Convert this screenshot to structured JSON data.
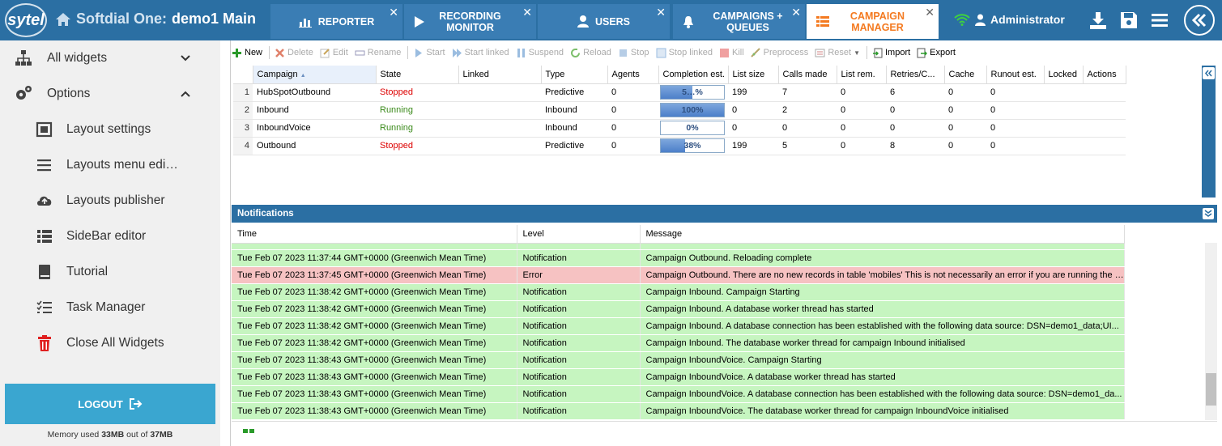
{
  "app": {
    "logo_text": "sytel",
    "product": "Softdial One:",
    "instance": "demo1 Main"
  },
  "tabs": [
    {
      "label": "REPORTER",
      "icon": "chart-icon"
    },
    {
      "label": "RECORDING MONITOR",
      "icon": "play-icon"
    },
    {
      "label": "USERS",
      "icon": "user-icon"
    },
    {
      "label": "CAMPAIGNS + QUEUES",
      "icon": "bell-icon"
    },
    {
      "label": "CAMPAIGN MANAGER",
      "icon": "grid-icon",
      "active": true
    }
  ],
  "header": {
    "user": "Administrator"
  },
  "sidebar": {
    "items": [
      {
        "label": "All widgets",
        "icon": "sitemap-icon"
      },
      {
        "label": "Options",
        "icon": "gears-icon"
      },
      {
        "label": "Layout settings",
        "icon": "layout-icon"
      },
      {
        "label": "Layouts menu edi…",
        "icon": "menu-icon"
      },
      {
        "label": "Layouts publisher",
        "icon": "cloud-upload-icon"
      },
      {
        "label": "SideBar editor",
        "icon": "list-icon"
      },
      {
        "label": "Tutorial",
        "icon": "book-icon"
      },
      {
        "label": "Task Manager",
        "icon": "tasks-icon"
      },
      {
        "label": "Close All Widgets",
        "icon": "trash-icon"
      }
    ],
    "logout_label": "LOGOUT",
    "memory_prefix": "Memory used ",
    "memory_used": "33MB",
    "memory_mid": " out of ",
    "memory_total": "37MB"
  },
  "toolbar": {
    "new": "New",
    "delete": "Delete",
    "edit": "Edit",
    "rename": "Rename",
    "start": "Start",
    "start_linked": "Start linked",
    "suspend": "Suspend",
    "reload": "Reload",
    "stop": "Stop",
    "stop_linked": "Stop linked",
    "kill": "Kill",
    "preprocess": "Preprocess",
    "reset": "Reset",
    "import": "Import",
    "export": "Export"
  },
  "campaigns": {
    "columns": [
      "Campaign",
      "State",
      "Linked",
      "Type",
      "Agents",
      "Completion est.",
      "List size",
      "Calls made",
      "List rem.",
      "Retries/C...",
      "Cache",
      "Runout est.",
      "Locked",
      "Actions"
    ],
    "rows": [
      {
        "n": "1",
        "campaign": "HubSpotOutbound",
        "state": "Stopped",
        "linked": "",
        "type": "Predictive",
        "agents": "0",
        "completion": 50,
        "completion_label": "5…%",
        "list_size": "199",
        "calls_made": "7",
        "list_rem": "0",
        "retries": "6",
        "cache": "0",
        "runout": "0"
      },
      {
        "n": "2",
        "campaign": "Inbound",
        "state": "Running",
        "linked": "",
        "type": "Inbound",
        "agents": "0",
        "completion": 100,
        "completion_label": "100%",
        "list_size": "0",
        "calls_made": "2",
        "list_rem": "0",
        "retries": "0",
        "cache": "0",
        "runout": "0"
      },
      {
        "n": "3",
        "campaign": "InboundVoice",
        "state": "Running",
        "linked": "",
        "type": "Inbound",
        "agents": "0",
        "completion": 0,
        "completion_label": "0%",
        "list_size": "0",
        "calls_made": "0",
        "list_rem": "0",
        "retries": "0",
        "cache": "0",
        "runout": "0"
      },
      {
        "n": "4",
        "campaign": "Outbound",
        "state": "Stopped",
        "linked": "",
        "type": "Predictive",
        "agents": "0",
        "completion": 38,
        "completion_label": "38%",
        "list_size": "199",
        "calls_made": "5",
        "list_rem": "0",
        "retries": "8",
        "cache": "0",
        "runout": "0"
      }
    ]
  },
  "notifications": {
    "title": "Notifications",
    "columns": [
      "Time",
      "Level",
      "Message"
    ],
    "rows": [
      {
        "time": "Tue Feb 07 2023 11:37:44 GMT+0000 (Greenwich Mean Time)",
        "level": "Notification",
        "message": "Campaign Outbound. Reloading complete"
      },
      {
        "time": "Tue Feb 07 2023 11:37:45 GMT+0000 (Greenwich Mean Time)",
        "level": "Error",
        "message": "Campaign Outbound. There are no new records in table 'mobiles' This is not necessarily an error if you are running the …"
      },
      {
        "time": "Tue Feb 07 2023 11:38:42 GMT+0000 (Greenwich Mean Time)",
        "level": "Notification",
        "message": "Campaign Inbound. Campaign Starting"
      },
      {
        "time": "Tue Feb 07 2023 11:38:42 GMT+0000 (Greenwich Mean Time)",
        "level": "Notification",
        "message": "Campaign Inbound. A database worker thread has started"
      },
      {
        "time": "Tue Feb 07 2023 11:38:42 GMT+0000 (Greenwich Mean Time)",
        "level": "Notification",
        "message": "Campaign Inbound. A database connection has been established with the following data source: DSN=demo1_data;UI..."
      },
      {
        "time": "Tue Feb 07 2023 11:38:42 GMT+0000 (Greenwich Mean Time)",
        "level": "Notification",
        "message": "Campaign Inbound. The database worker thread for campaign Inbound initialised"
      },
      {
        "time": "Tue Feb 07 2023 11:38:43 GMT+0000 (Greenwich Mean Time)",
        "level": "Notification",
        "message": "Campaign InboundVoice. Campaign Starting"
      },
      {
        "time": "Tue Feb 07 2023 11:38:43 GMT+0000 (Greenwich Mean Time)",
        "level": "Notification",
        "message": "Campaign InboundVoice. A database worker thread has started"
      },
      {
        "time": "Tue Feb 07 2023 11:38:43 GMT+0000 (Greenwich Mean Time)",
        "level": "Notification",
        "message": "Campaign InboundVoice. A database connection has been established with the following data source: DSN=demo1_da..."
      },
      {
        "time": "Tue Feb 07 2023 11:38:43 GMT+0000 (Greenwich Mean Time)",
        "level": "Notification",
        "message": "Campaign InboundVoice. The database worker thread for campaign InboundVoice initialised"
      }
    ]
  },
  "colors": {
    "header_blue": "#2b6fa3",
    "active_tab_text": "#f47a20",
    "logout_bg": "#3aa6d0",
    "notification_green": "#c6f5c0",
    "error_red": "#f6c2c2"
  }
}
